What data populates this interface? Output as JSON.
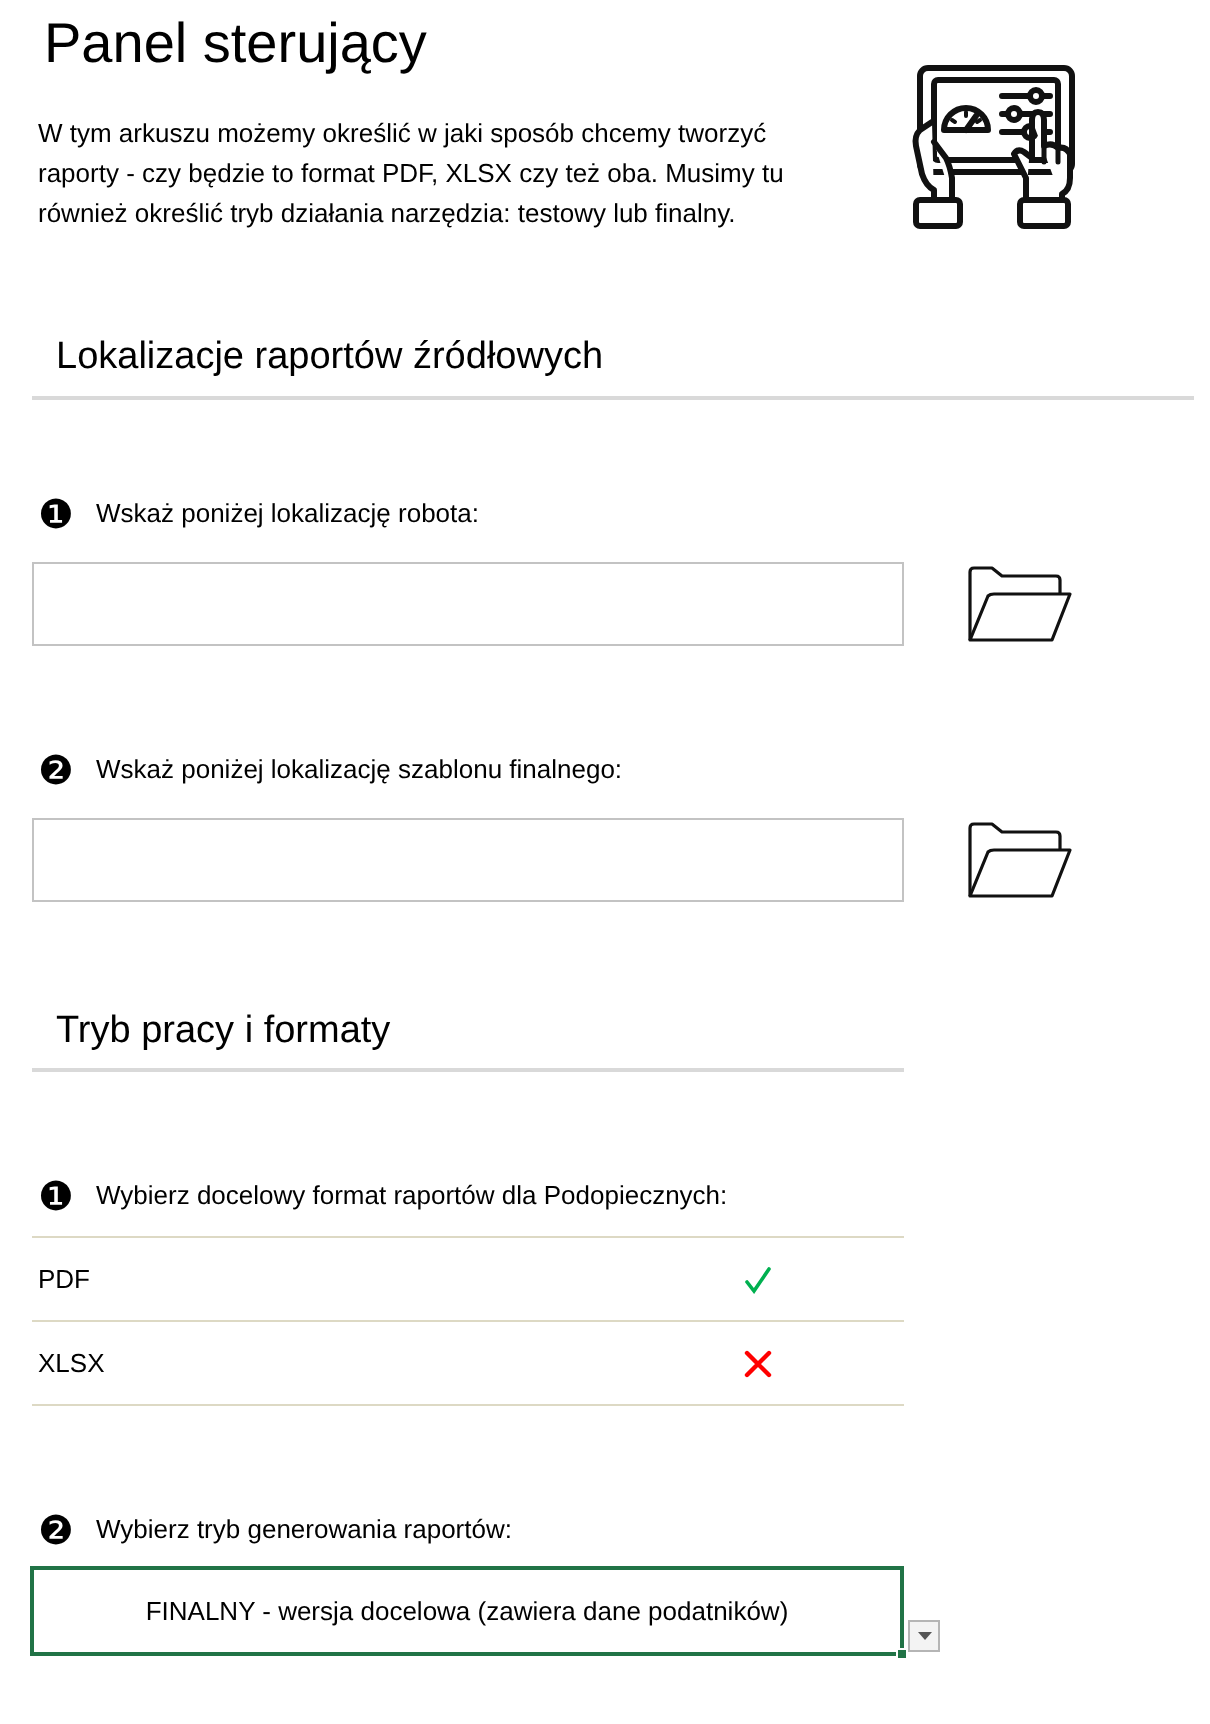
{
  "title": "Panel sterujący",
  "description": "W tym arkuszu możemy określić w jaki sposób chcemy tworzyć raporty - czy będzie to format PDF, XLSX czy też oba. Musimy tu również określić tryb działania narzędzia: testowy lub finalny.",
  "sections": [
    {
      "heading": "Lokalizacje raportów źródłowych",
      "items": [
        {
          "kind": "path",
          "marker": "❶",
          "label": "Wskaż poniżej lokalizację robota:"
        },
        {
          "kind": "path",
          "marker": "❷",
          "label": "Wskaż poniżej lokalizację szablonu finalnego:"
        }
      ]
    },
    {
      "heading": "Tryb pracy i formaty",
      "items": [
        {
          "kind": "formats",
          "marker": "❶",
          "label": "Wybierz docelowy format raportów dla Podopiecznych:",
          "options": [
            {
              "name": "PDF",
              "checked": true
            },
            {
              "name": "XLSX",
              "checked": false
            }
          ]
        },
        {
          "kind": "dropdown",
          "marker": "❷",
          "label": "Wybierz tryb generowania raportów:",
          "value": "FINALNY - wersja docelowa (zawiera dane podatników)"
        }
      ]
    }
  ]
}
